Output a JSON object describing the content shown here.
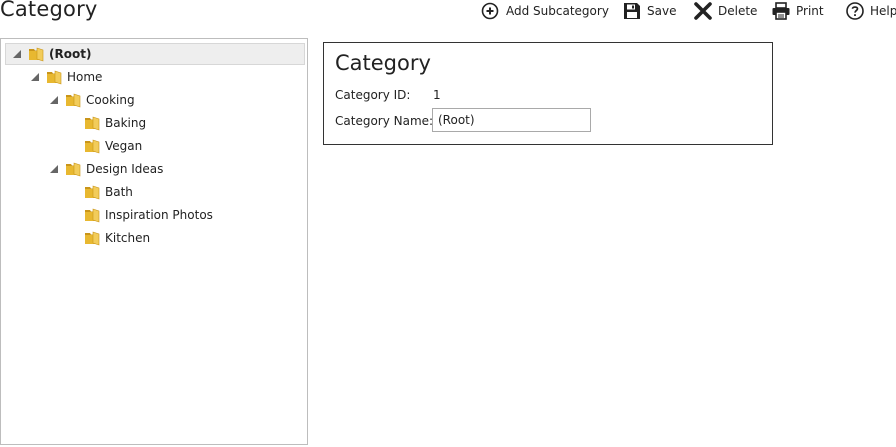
{
  "page": {
    "title": "Category"
  },
  "toolbar": {
    "add_subcategory": "Add Subcategory",
    "save": "Save",
    "delete": "Delete",
    "print": "Print",
    "help": "Help"
  },
  "tree": {
    "root": "(Root)",
    "home": "Home",
    "cooking": "Cooking",
    "baking": "Baking",
    "vegan": "Vegan",
    "design_ideas": "Design Ideas",
    "bath": "Bath",
    "inspiration_photos": "Inspiration Photos",
    "kitchen": "Kitchen"
  },
  "detail": {
    "title": "Category",
    "id_label": "Category ID:",
    "id_value": "1",
    "name_label": "Category Name:",
    "name_value": "(Root)"
  },
  "colors": {
    "folder": "#e8b830",
    "folder_dark": "#c9951a",
    "selected_bg": "#eeeeee"
  }
}
